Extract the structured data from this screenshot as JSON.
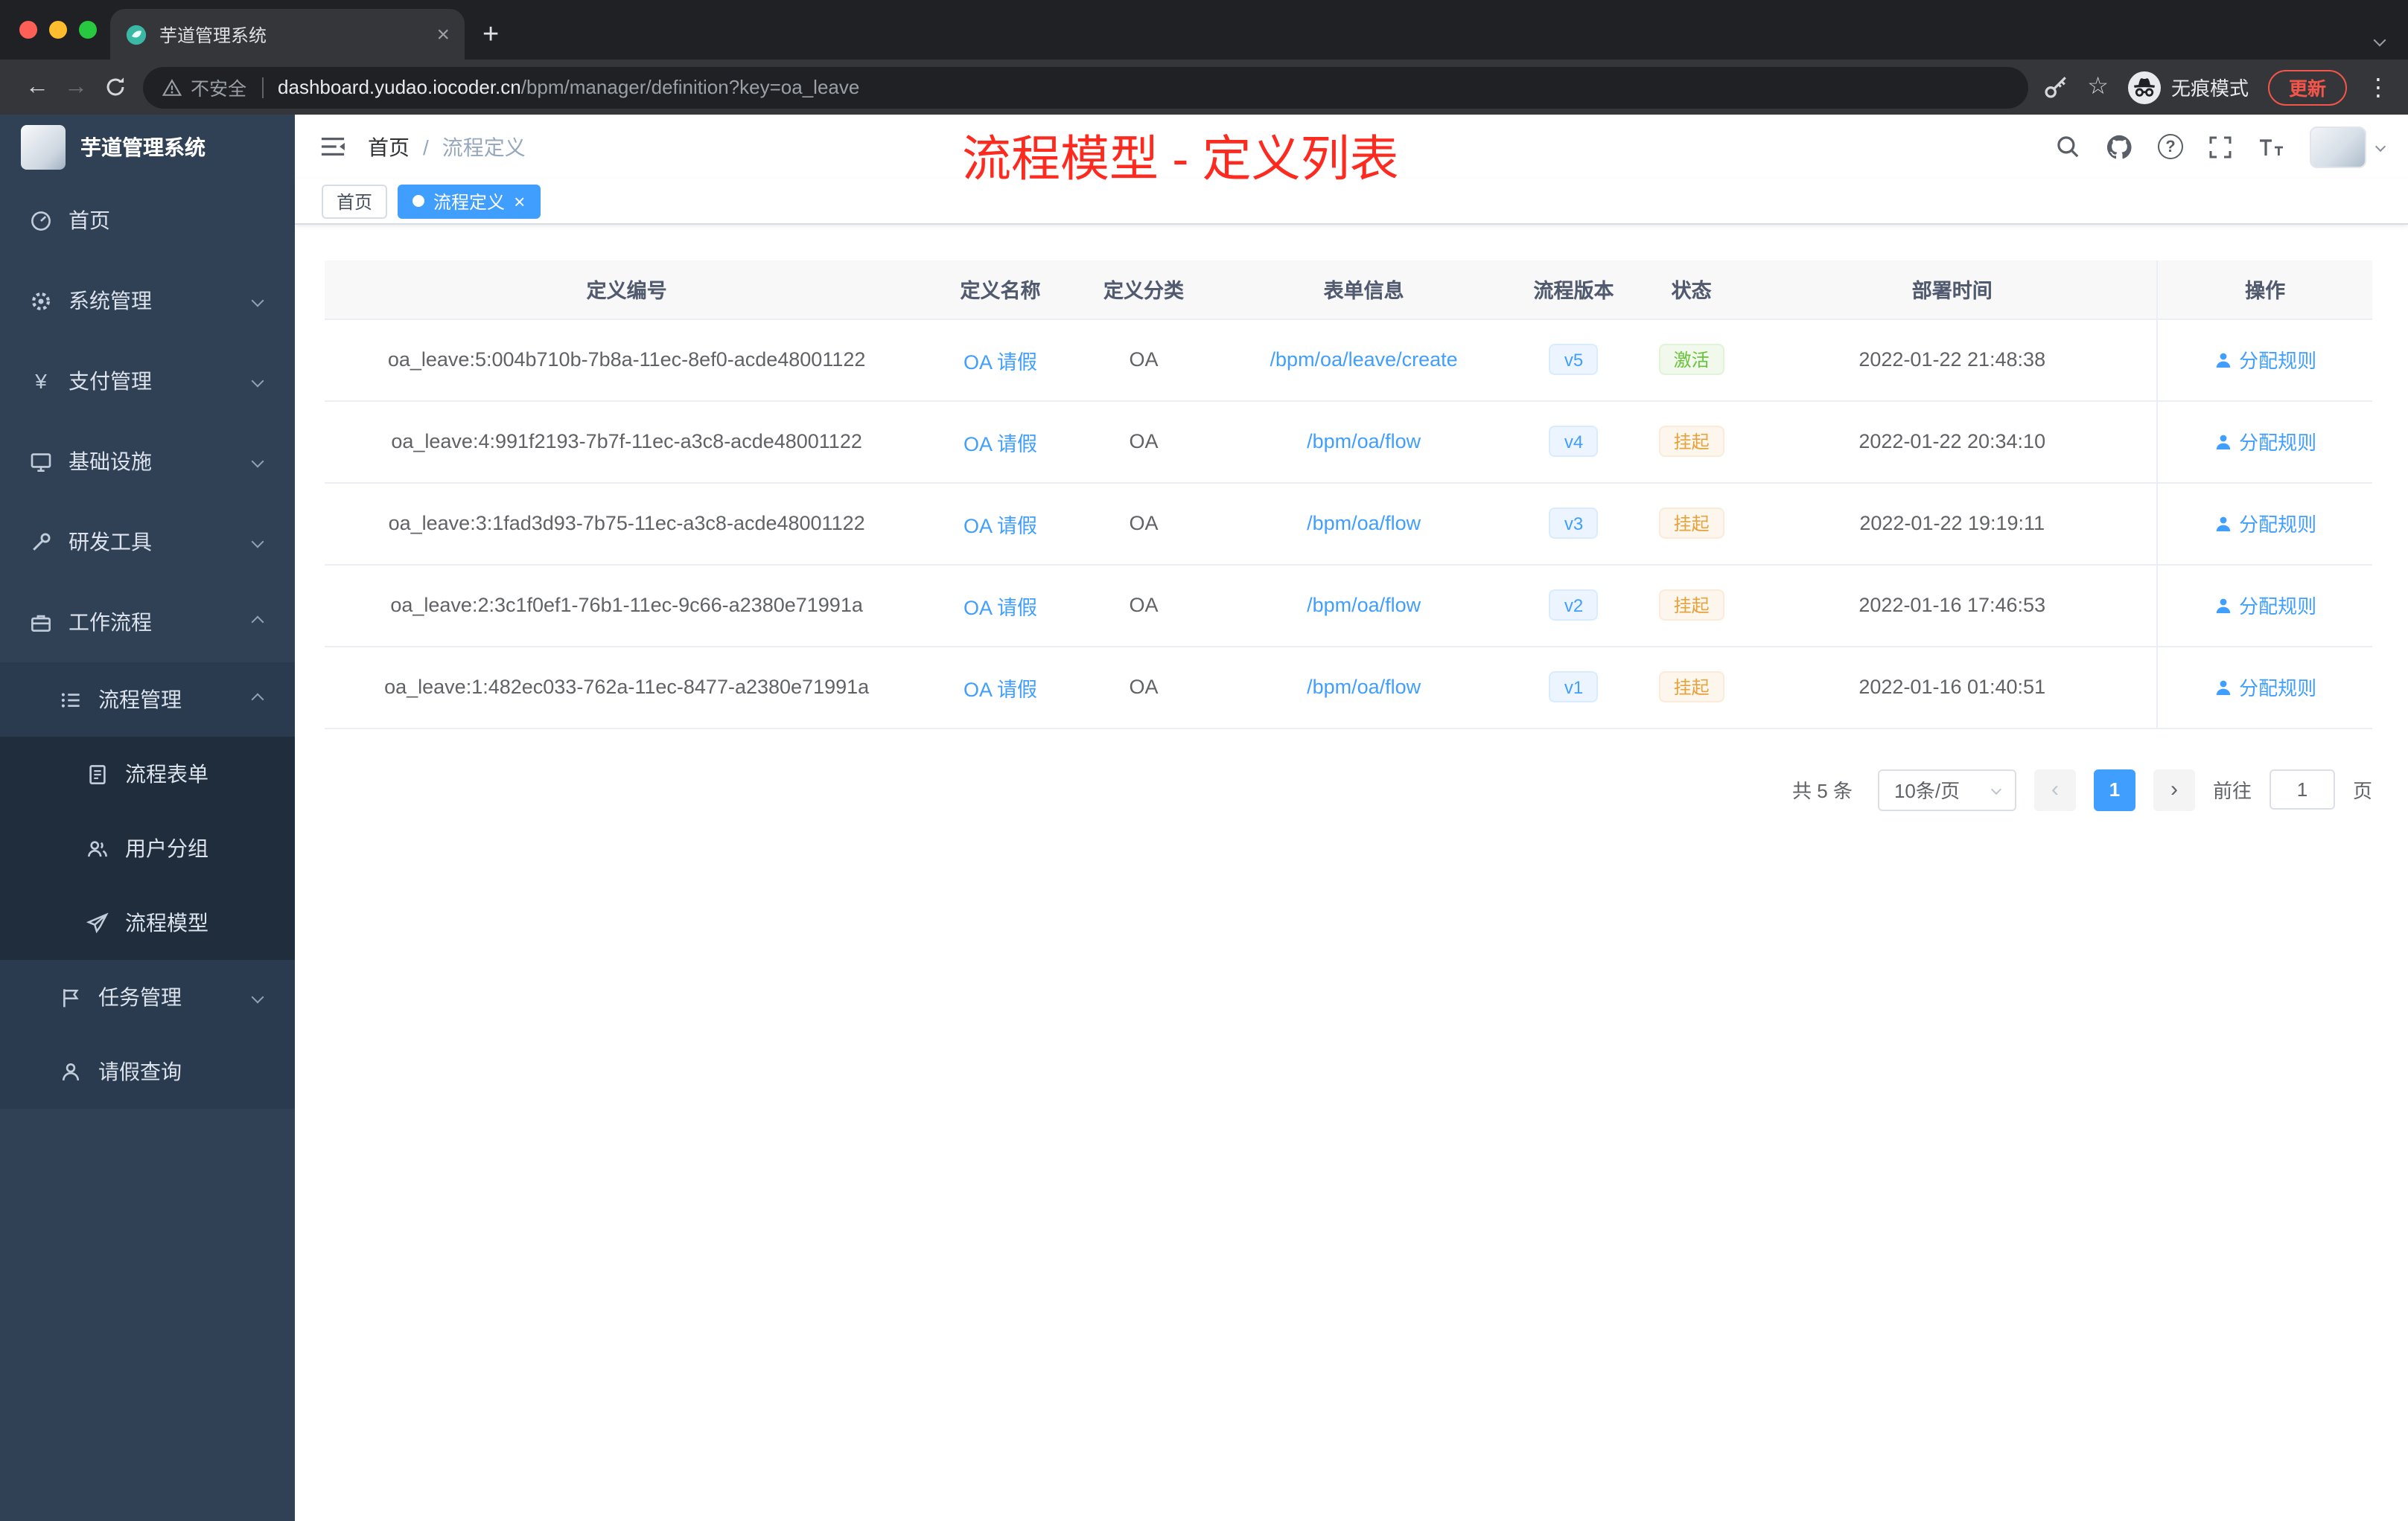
{
  "colors": {
    "accent": "#409eff",
    "annotation_red": "#fd2a20",
    "sidebar_bg": "#304156",
    "status_active": "#67c23a",
    "status_suspended": "#e6a23c"
  },
  "icons": {
    "close": "×",
    "new_tab": "+",
    "back": "←",
    "forward": "→",
    "star": "☆",
    "menu_dots": "⋮",
    "help": "?",
    "yen": "¥",
    "prev": "‹",
    "next": "›",
    "tag_close": "×"
  },
  "browser": {
    "tab_title": "芋道管理系统",
    "security_label": "不安全",
    "url_domain": "dashboard.yudao.iocoder.cn",
    "url_path": "/bpm/manager/definition?key=oa_leave",
    "incognito_label": "无痕模式",
    "update_label": "更新"
  },
  "sidebar": {
    "logo_title": "芋道管理系统",
    "items": [
      {
        "label": "首页",
        "level": 1,
        "icon": "dashboard-icon"
      },
      {
        "label": "系统管理",
        "level": 1,
        "icon": "gear-icon",
        "chevron": "down"
      },
      {
        "label": "支付管理",
        "level": 1,
        "icon": "yen-icon",
        "chevron": "down"
      },
      {
        "label": "基础设施",
        "level": 1,
        "icon": "monitor-icon",
        "chevron": "down"
      },
      {
        "label": "研发工具",
        "level": 1,
        "icon": "tools-icon",
        "chevron": "down"
      },
      {
        "label": "工作流程",
        "level": 1,
        "icon": "briefcase-icon",
        "chevron": "up"
      },
      {
        "label": "流程管理",
        "level": 2,
        "icon": "list-icon",
        "chevron": "up"
      },
      {
        "label": "流程表单",
        "level": 3,
        "icon": "form-icon"
      },
      {
        "label": "用户分组",
        "level": 3,
        "icon": "user-group-icon"
      },
      {
        "label": "流程模型",
        "level": 3,
        "icon": "paper-plane-icon"
      },
      {
        "label": "任务管理",
        "level": 2,
        "icon": "flag-icon",
        "chevron": "down"
      },
      {
        "label": "请假查询",
        "level": 2,
        "icon": "user-icon"
      }
    ]
  },
  "header": {
    "breadcrumb_home": "首页",
    "breadcrumb_sep": "/",
    "breadcrumb_current": "流程定义",
    "annotation": "流程模型 - 定义列表"
  },
  "tags": {
    "home": "首页",
    "active": "流程定义"
  },
  "table": {
    "columns": [
      "定义编号",
      "定义名称",
      "定义分类",
      "表单信息",
      "流程版本",
      "状态",
      "部署时间",
      "操作"
    ],
    "rows": [
      {
        "id": "oa_leave:5:004b710b-7b8a-11ec-8ef0-acde48001122",
        "name": "OA 请假",
        "category": "OA",
        "form": "/bpm/oa/leave/create",
        "version": "v5",
        "status": "激活",
        "status_type": "success",
        "time": "2022-01-22 21:48:38",
        "action": "分配规则"
      },
      {
        "id": "oa_leave:4:991f2193-7b7f-11ec-a3c8-acde48001122",
        "name": "OA 请假",
        "category": "OA",
        "form": "/bpm/oa/flow",
        "version": "v4",
        "status": "挂起",
        "status_type": "warning",
        "time": "2022-01-22 20:34:10",
        "action": "分配规则"
      },
      {
        "id": "oa_leave:3:1fad3d93-7b75-11ec-a3c8-acde48001122",
        "name": "OA 请假",
        "category": "OA",
        "form": "/bpm/oa/flow",
        "version": "v3",
        "status": "挂起",
        "status_type": "warning",
        "time": "2022-01-22 19:19:11",
        "action": "分配规则"
      },
      {
        "id": "oa_leave:2:3c1f0ef1-76b1-11ec-9c66-a2380e71991a",
        "name": "OA 请假",
        "category": "OA",
        "form": "/bpm/oa/flow",
        "version": "v2",
        "status": "挂起",
        "status_type": "warning",
        "time": "2022-01-16 17:46:53",
        "action": "分配规则"
      },
      {
        "id": "oa_leave:1:482ec033-762a-11ec-8477-a2380e71991a",
        "name": "OA 请假",
        "category": "OA",
        "form": "/bpm/oa/flow",
        "version": "v1",
        "status": "挂起",
        "status_type": "warning",
        "time": "2022-01-16 01:40:51",
        "action": "分配规则"
      }
    ]
  },
  "pagination": {
    "total": "共 5 条",
    "page_size": "10条/页",
    "current_page": "1",
    "goto_label": "前往",
    "goto_value": "1",
    "unit_label": "页"
  }
}
